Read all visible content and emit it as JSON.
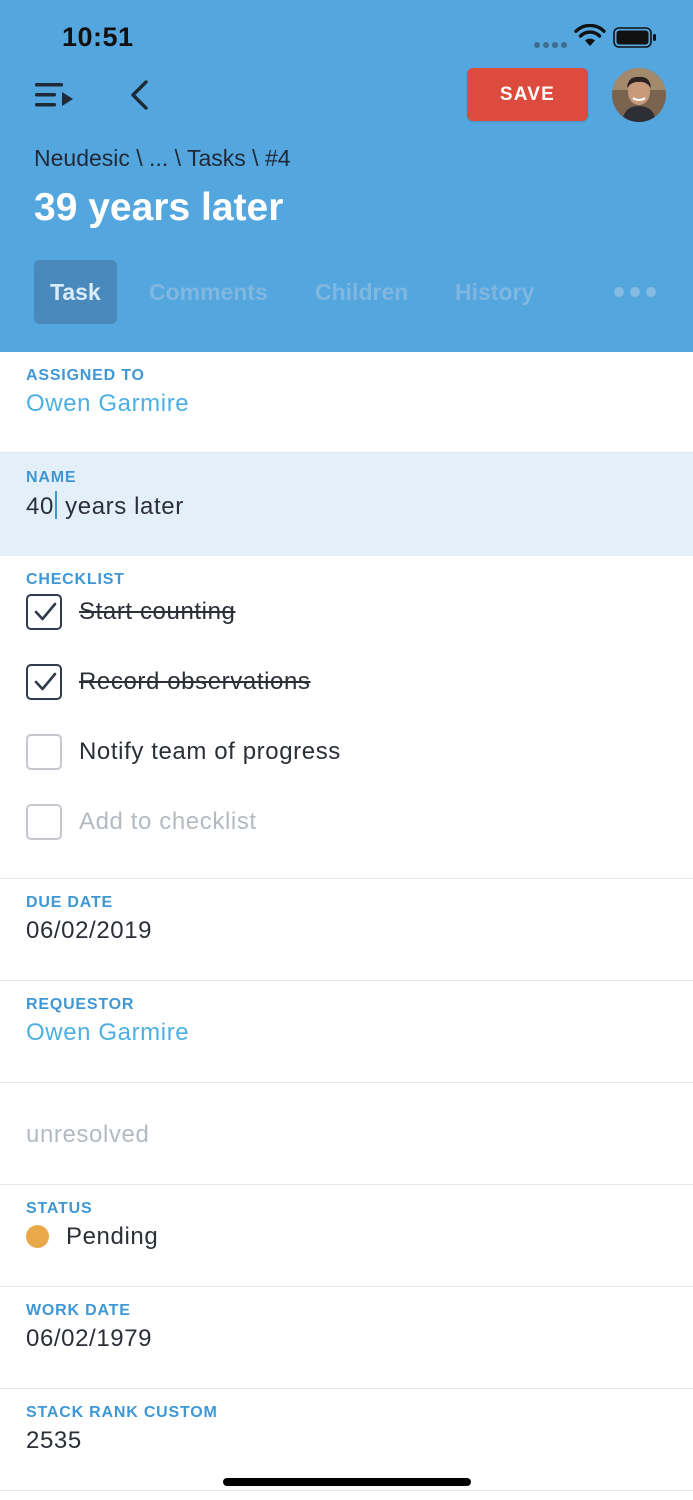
{
  "status_bar": {
    "time": "10:51"
  },
  "header": {
    "save_label": "SAVE",
    "breadcrumb": "Neudesic \\ ... \\ Tasks \\ #4",
    "title": "39 years later",
    "tabs": [
      {
        "label": "Task",
        "active": true
      },
      {
        "label": "Comments",
        "active": false
      },
      {
        "label": "Children",
        "active": false
      },
      {
        "label": "History",
        "active": false
      }
    ],
    "more_icon": "more-horizontal-icon"
  },
  "fields": {
    "assigned_to": {
      "label": "ASSIGNED TO",
      "value": "Owen Garmire"
    },
    "name": {
      "label": "NAME",
      "value_before_cursor": "40",
      "value_after_cursor": " years later"
    },
    "checklist": {
      "label": "CHECKLIST",
      "items": [
        {
          "label": "Start counting",
          "checked": true
        },
        {
          "label": "Record observations",
          "checked": true
        },
        {
          "label": "Notify team of progress",
          "checked": false
        }
      ],
      "add_placeholder": "Add to checklist"
    },
    "due_date": {
      "label": "DUE DATE",
      "value": "06/02/2019"
    },
    "requestor": {
      "label": "REQUESTOR",
      "value": "Owen Garmire"
    },
    "resolution": {
      "value": "unresolved"
    },
    "status": {
      "label": "STATUS",
      "value": "Pending",
      "color": "#e9a84a"
    },
    "work_date": {
      "label": "WORK DATE",
      "value": "06/02/1979"
    },
    "stack_rank_custom": {
      "label": "STACK RANK CUSTOM",
      "value": "2535"
    }
  },
  "colors": {
    "header_bg": "#54a6df",
    "save_bg": "#dc4b3e",
    "label_blue": "#3f97d4",
    "link_blue": "#4eb0e2",
    "name_field_bg": "#e3eff9"
  }
}
